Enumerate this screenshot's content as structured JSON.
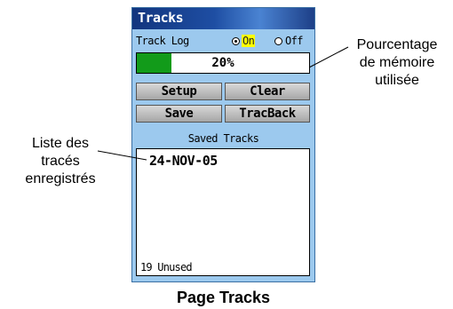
{
  "window": {
    "title": "Tracks"
  },
  "track_log": {
    "label": "Track Log",
    "options": [
      {
        "label": "On",
        "selected": true
      },
      {
        "label": "Off",
        "selected": false
      }
    ]
  },
  "memory": {
    "percent": 20,
    "percent_label": "20%"
  },
  "buttons": {
    "setup": "Setup",
    "clear": "Clear",
    "save": "Save",
    "tracback": "TracBack"
  },
  "saved_tracks": {
    "header": "Saved Tracks",
    "items": [
      "24-NOV-05"
    ],
    "unused": "19 Unused"
  },
  "annotations": {
    "memory_callout": [
      "Pourcentage",
      "de mémoire",
      "utilisée"
    ],
    "list_callout": [
      "Liste des",
      "tracés",
      "enregistrés"
    ]
  },
  "caption": "Page Tracks",
  "colors": {
    "title_bar": "#12357e",
    "panel": "#9cc9ee",
    "memory_fill": "#129b1a",
    "selected_option": "#ffff00"
  }
}
